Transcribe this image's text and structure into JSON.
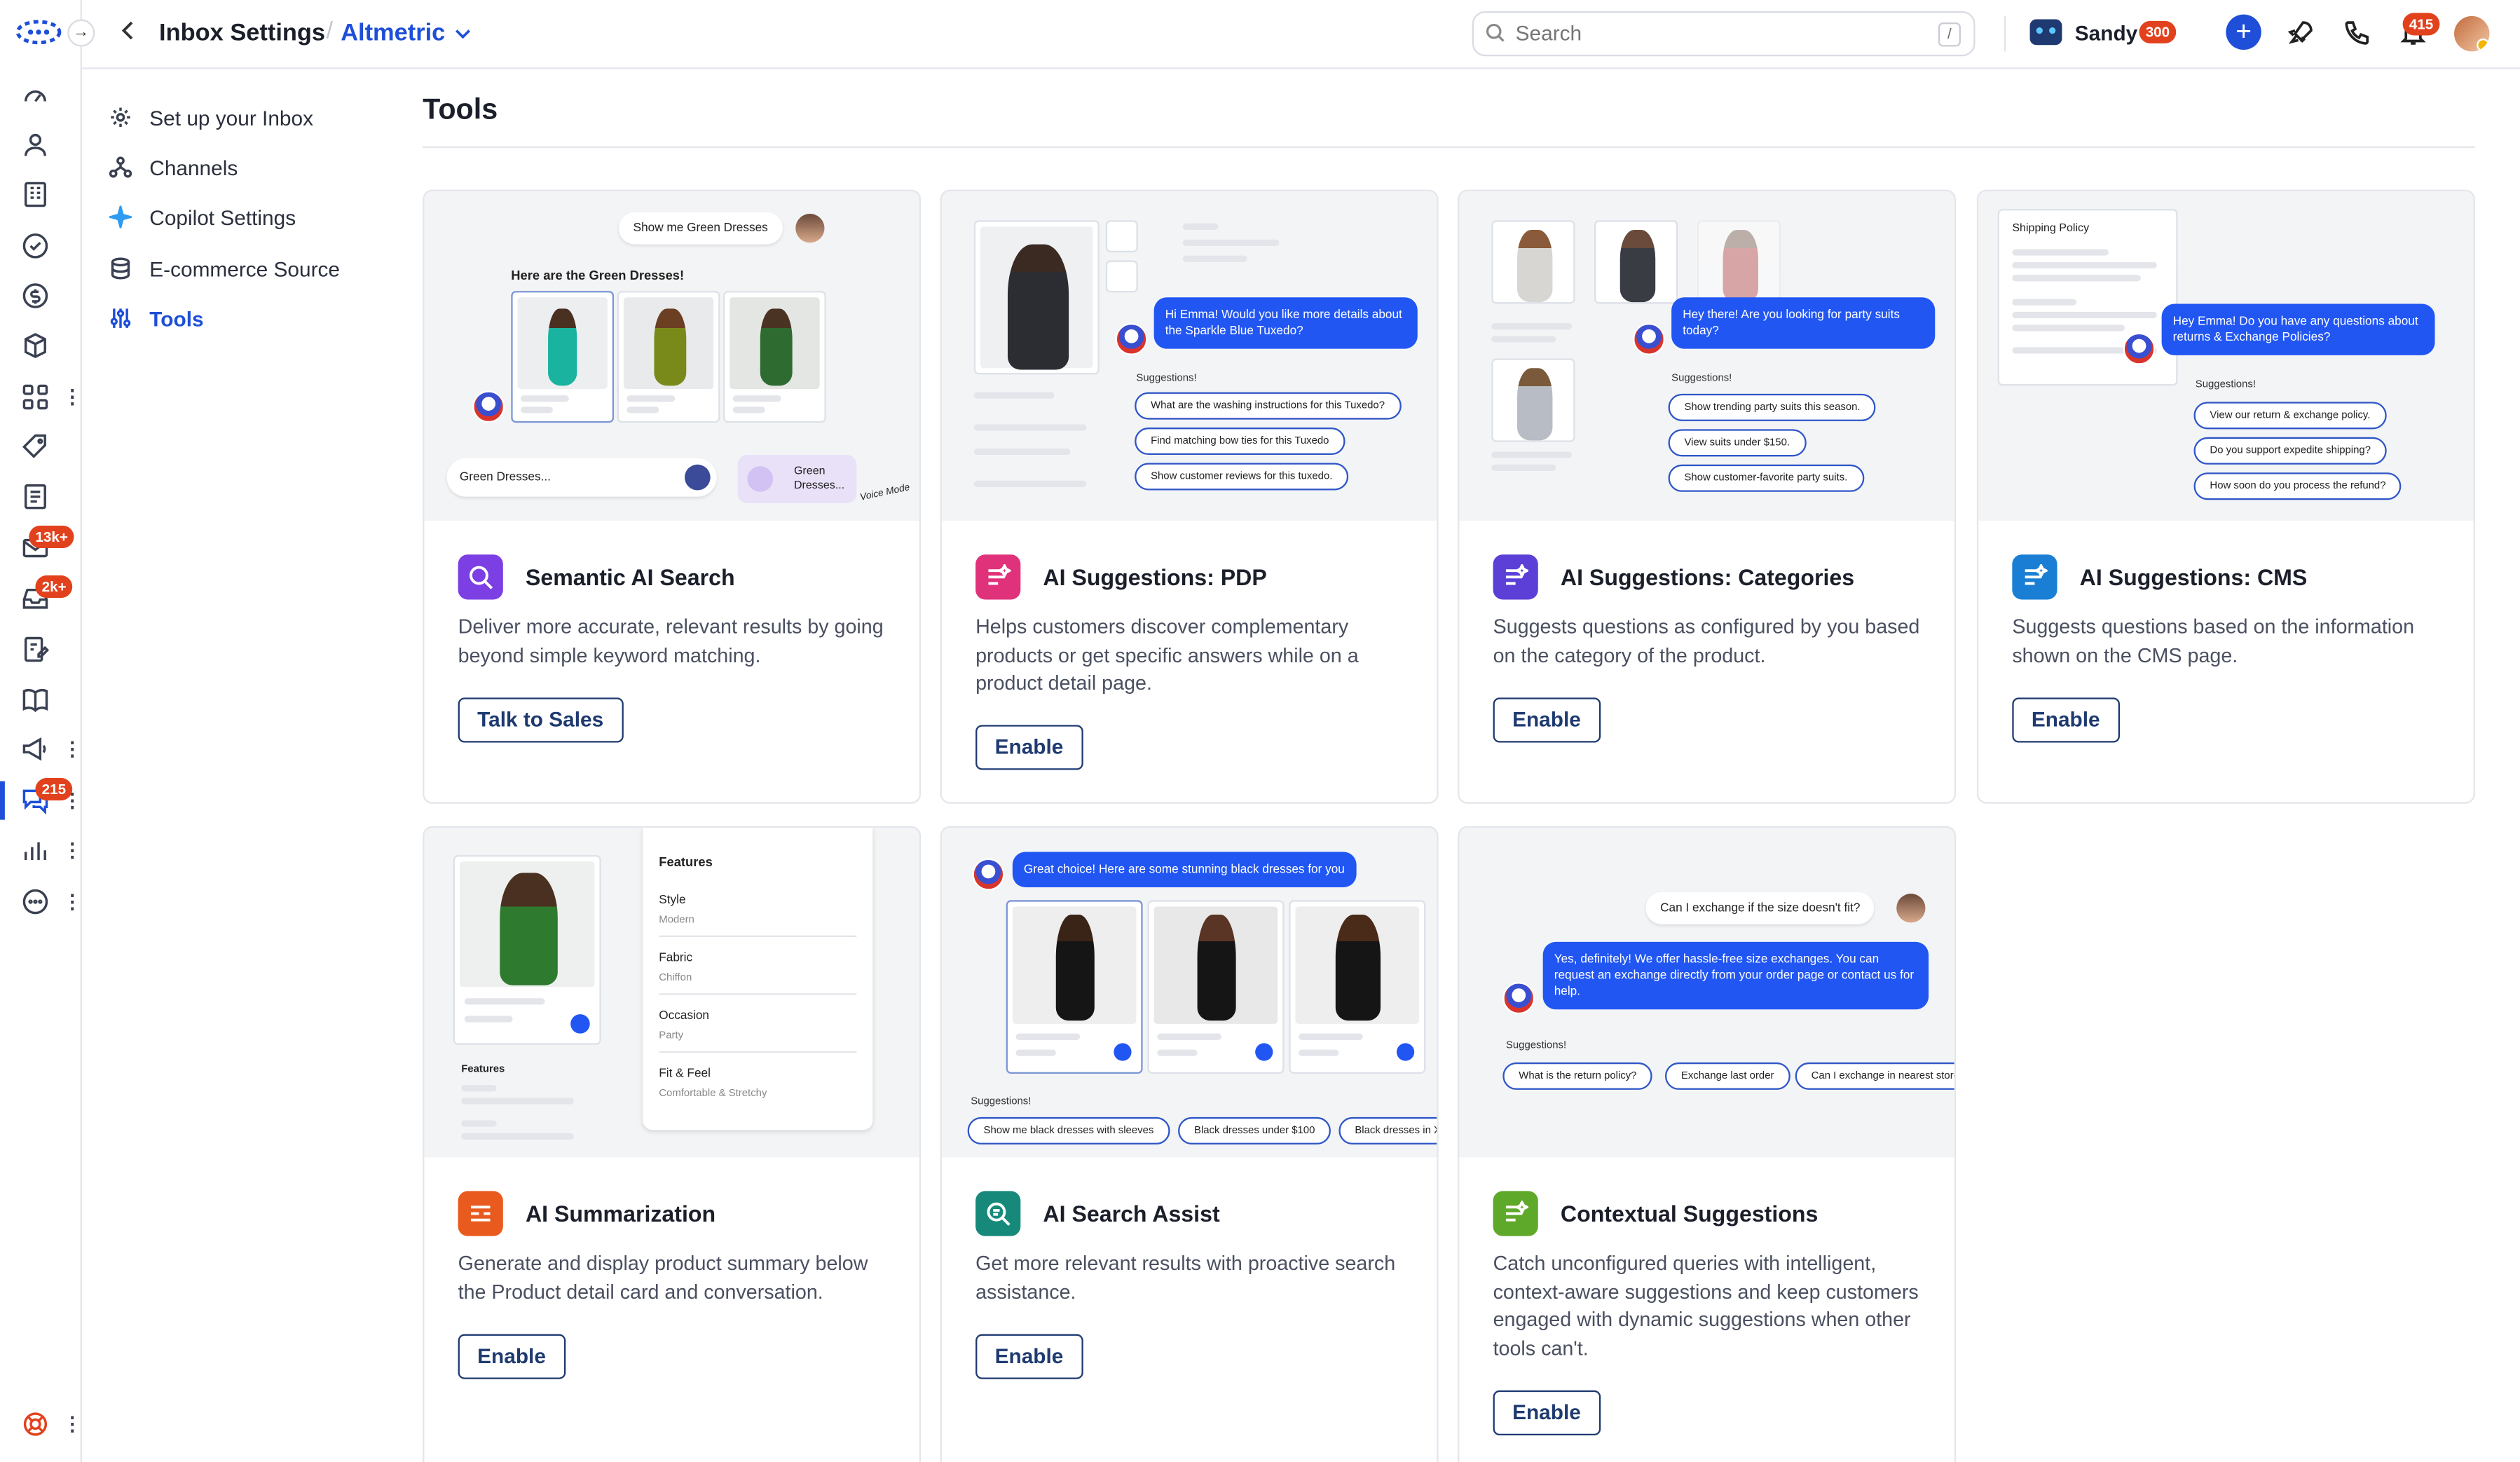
{
  "header": {
    "back_icon": "chevron-left-icon",
    "title": "Inbox Settings",
    "workspace": "Altmetric",
    "search_placeholder": "Search",
    "search_shortcut": "/",
    "user_name": "Sandy",
    "user_count": "300",
    "notification_count": "415"
  },
  "rail": {
    "badges": {
      "mail": "13k+",
      "inbox": "2k+",
      "chat": "215"
    }
  },
  "settings_nav": {
    "items": [
      {
        "label": "Set up your Inbox",
        "icon": "gear-icon"
      },
      {
        "label": "Channels",
        "icon": "channels-icon"
      },
      {
        "label": "Copilot Settings",
        "icon": "sparkle-icon"
      },
      {
        "label": "E-commerce Source",
        "icon": "database-icon"
      },
      {
        "label": "Tools",
        "icon": "tools-icon"
      }
    ],
    "active": "Tools"
  },
  "page": {
    "title": "Tools"
  },
  "colors": {
    "accent": "#1f4fd8",
    "badge": "#e1421d",
    "button_border": "#1e3a70"
  },
  "tools": [
    {
      "title": "Semantic AI Search",
      "description": "Deliver more accurate, relevant results by going beyond simple keyword matching.",
      "button": "Talk to Sales",
      "icon_color": "#7b3fe4",
      "preview": {
        "user_message": "Show me Green Dresses",
        "bot_heading": "Here are the Green Dresses!",
        "input_value": "Green Dresses...",
        "voice_label": "Green Dresses...",
        "voice_mode": "Voice Mode"
      }
    },
    {
      "title": "AI Suggestions: PDP",
      "description": "Helps customers discover complementary products or get specific answers while on a product detail page.",
      "button": "Enable",
      "icon_color": "#e0327a",
      "preview": {
        "bot_message": "Hi Emma! Would you like more details about the Sparkle Blue Tuxedo?",
        "suggestions_label": "Suggestions!",
        "chips": [
          "What are the washing instructions for this Tuxedo?",
          "Find matching bow ties for this Tuxedo",
          "Show customer reviews for this tuxedo."
        ]
      }
    },
    {
      "title": "AI Suggestions: Categories",
      "description": "Suggests questions as configured by you based on the category of the product.",
      "button": "Enable",
      "icon_color": "#5b3fd6",
      "preview": {
        "bot_message": "Hey there! Are you looking for party suits today?",
        "suggestions_label": "Suggestions!",
        "chips": [
          "Show trending party suits this season.",
          "View suits under $150.",
          "Show customer-favorite party suits."
        ]
      }
    },
    {
      "title": "AI Suggestions: CMS",
      "description": "Suggests questions based on the information shown on the CMS page.",
      "button": "Enable",
      "icon_color": "#1a7fd4",
      "preview": {
        "doc_title": "Shipping Policy",
        "bot_message": "Hey Emma! Do you have any questions about returns & Exchange Policies?",
        "suggestions_label": "Suggestions!",
        "chips": [
          "View our return & exchange policy.",
          "Do you support expedite shipping?",
          "How soon do you process the refund?"
        ]
      }
    },
    {
      "title": "AI Summarization",
      "description": "Generate and display product summary below the Product detail card and conversation.",
      "button": "Enable",
      "icon_color": "#e85a1e",
      "preview": {
        "features_heading": "Features",
        "features_small": "Features",
        "features": [
          {
            "name": "Style",
            "value": "Modern"
          },
          {
            "name": "Fabric",
            "value": "Chiffon"
          },
          {
            "name": "Occasion",
            "value": "Party"
          },
          {
            "name": "Fit & Feel",
            "value": "Comfortable & Stretchy"
          }
        ]
      }
    },
    {
      "title": "AI Search Assist",
      "description": "Get more relevant results with proactive search assistance.",
      "button": "Enable",
      "icon_color": "#17897a",
      "preview": {
        "bot_message": "Great choice! Here are some stunning black dresses for you",
        "suggestions_label": "Suggestions!",
        "chips": [
          "Show me black dresses with sleeves",
          "Black dresses under $100",
          "Black dresses in X"
        ]
      }
    },
    {
      "title": "Contextual Suggestions",
      "description": "Catch unconfigured queries with intelligent, context-aware suggestions and keep customers engaged with dynamic suggestions when other tools can't.",
      "button": "Enable",
      "icon_color": "#5ea82a",
      "preview": {
        "user_message": "Can I exchange if the size doesn't fit?",
        "bot_message": "Yes, definitely! We offer hassle-free size exchanges. You can request an exchange directly from your order page or contact us for help.",
        "suggestions_label": "Suggestions!",
        "chips": [
          "What is the return policy?",
          "Exchange last order",
          "Can I exchange in nearest store"
        ]
      }
    }
  ]
}
